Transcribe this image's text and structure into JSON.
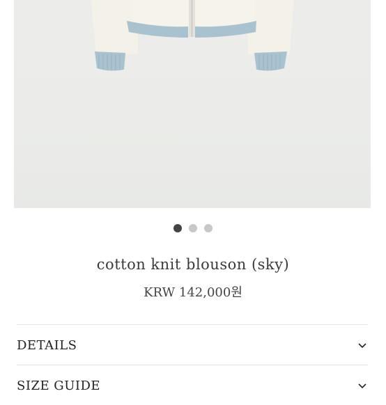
{
  "gallery": {
    "image_alt": "cotton knit blouson (sky)",
    "slides": [
      {
        "active": true
      },
      {
        "active": false
      },
      {
        "active": false
      }
    ],
    "colors": {
      "knit_body": "#f4f1e8",
      "rib_trim": "#a9c2cf"
    }
  },
  "product": {
    "name": "cotton knit blouson (sky)",
    "price": "KRW 142,000원"
  },
  "accordion": {
    "details_label": "DETAILS",
    "size_guide_label": "SIZE GUIDE",
    "chevron_icon": "chevron-down-icon"
  }
}
